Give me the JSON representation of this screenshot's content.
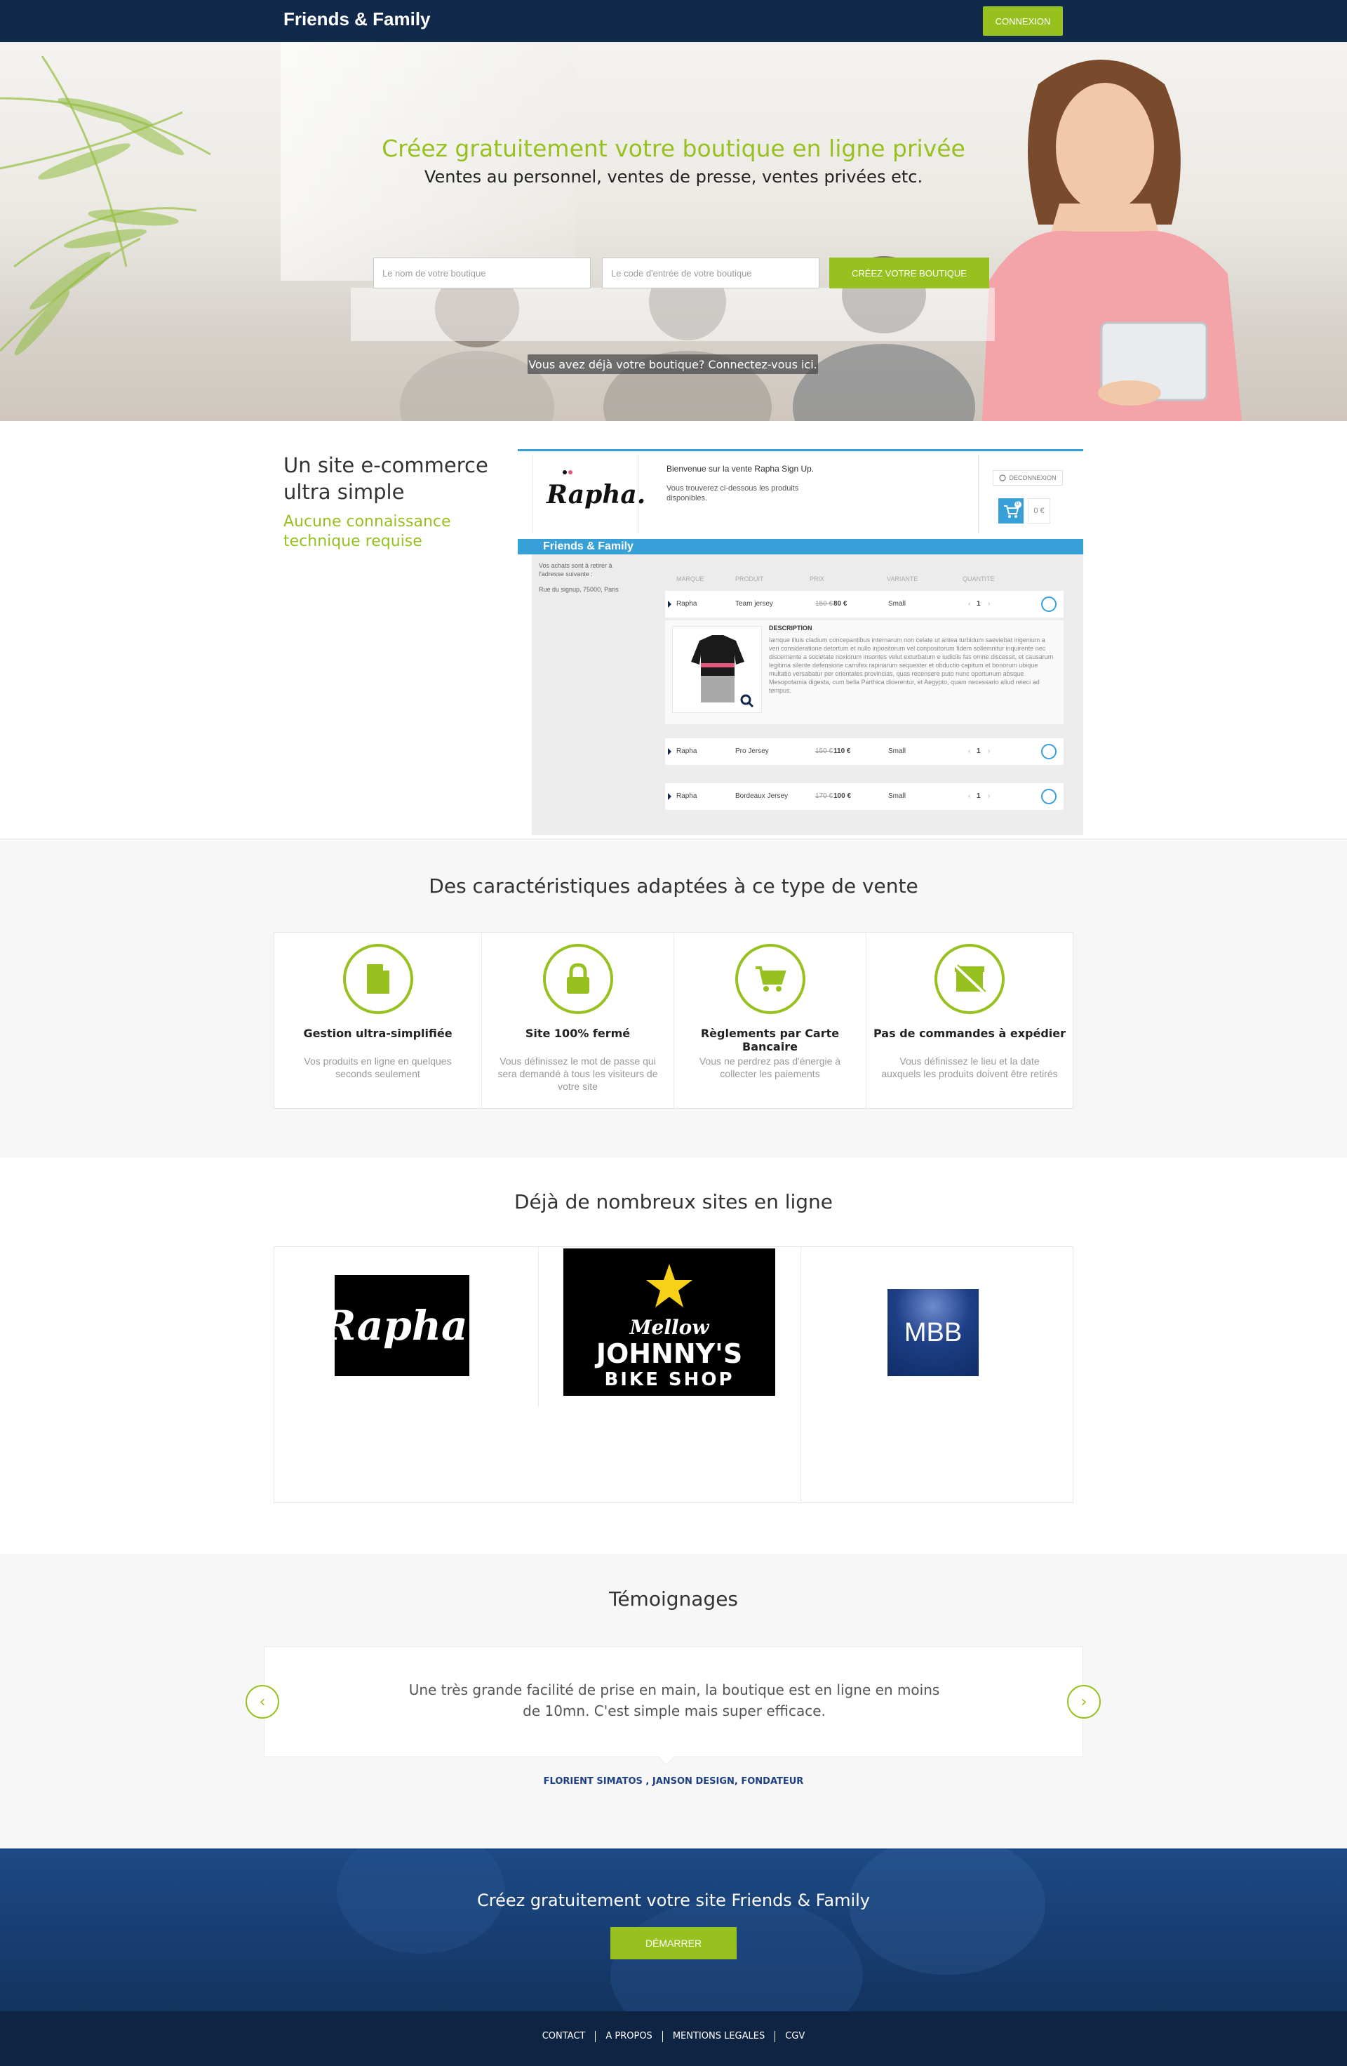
{
  "header": {
    "brand": "Friends & Family",
    "login_label": "CONNEXION"
  },
  "hero": {
    "title": "Créez gratuitement votre boutique en ligne privée",
    "subtitle": "Ventes au personnel, ventes de presse, ventes privées etc.",
    "shop_name_placeholder": "Le nom de votre boutique",
    "shop_code_placeholder": "Le code d'entrée de votre boutique",
    "create_label": "CRÉEZ VOTRE BOUTIQUE",
    "already_label": "Vous avez déjà votre boutique? Connectez-vous ici."
  },
  "ecommerce": {
    "title": "Un site e-commerce ultra simple",
    "subtitle": "Aucune connaissance technique requise",
    "mockup": {
      "logo": "Rapha.",
      "welcome": "Bienvenue sur la vente Rapha Sign Up.",
      "desc": "Vous trouverez ci-dessous les produits disponibles.",
      "logout": "DECONNEXION",
      "cart_count": "0",
      "cart_total": "0 €",
      "bar_title": "Friends & Family",
      "side_text_1": "Vos achats sont à retirer à l'adresse suivante :",
      "side_text_2": "Rue du signup, 75000, Paris",
      "columns": [
        "MARQUE",
        "PRODUIT",
        "PRIX",
        "VARIANTE",
        "QUANTITE"
      ],
      "rows": [
        {
          "brand": "Rapha",
          "product": "Team jersey",
          "old_price": "150 €",
          "price": "80 €",
          "variant": "Small",
          "qty": "1"
        },
        {
          "brand": "Rapha",
          "product": "Pro Jersey",
          "old_price": "150 €",
          "price": "110 €",
          "variant": "Small",
          "qty": "1"
        },
        {
          "brand": "Rapha",
          "product": "Bordeaux Jersey",
          "old_price": "170 €",
          "price": "100 €",
          "variant": "Small",
          "qty": "1"
        }
      ],
      "description_title": "DESCRIPTION",
      "description_text": "Iamque illuis cladium concepantibus internarum non celate ut antea turbidum saeviebat ingenium a veri consideratione detortum et nullo inpositorum vel conpositorum fidem sollemnitur inquirente nec discernente a societate noxiorum insontes velut exturbatum e iudiciis fas omne discessit, et causarum legitima silente defensione carnifex rapinarum sequester et obductio capitum et bonorum ubique multatio versabatur per orientales provincias, quas recensere puto nunc oportunum absque Mesopotamia digesta, cum bella Parthica dicerentur, et Aegypto, quam necessario aliud reieci ad tempus."
    }
  },
  "features": {
    "title": "Des caractéristiques adaptées à ce type de vente",
    "items": [
      {
        "icon": "document-icon",
        "title": "Gestion ultra-simplifiée",
        "text": "Vos produits en ligne en quelques seconds seulement"
      },
      {
        "icon": "lock-icon",
        "title": "Site 100% fermé",
        "text": "Vous définissez le mot de passe qui sera demandé à tous les visiteurs de votre site"
      },
      {
        "icon": "cart-icon",
        "title": "Règlements par Carte Bancaire",
        "text": "Vous ne perdrez pas d'énergie à collecter les paiements"
      },
      {
        "icon": "no-shipping-icon",
        "title": "Pas de commandes à expédier",
        "text": "Vous définissez le lieu et la date auxquels les produits doivent être retirés"
      }
    ]
  },
  "sites": {
    "title": "Déjà de nombreux sites en ligne",
    "logos": {
      "rapha": "Rapha.",
      "mjbs_1": "Mellow",
      "mjbs_2": "JOHNNY'S",
      "mjbs_3": "BIKE SHOP",
      "mbb": "MBB"
    }
  },
  "testimonials": {
    "title": "Témoignages",
    "quote": "Une très grande facilité de prise en main, la boutique est en ligne en moins de 10mn. C'est simple mais super efficace.",
    "author": "FLORIENT SIMATOS , JANSON DESIGN, FONDATEUR",
    "prev": "‹",
    "next": "›"
  },
  "cta": {
    "title": "Créez gratuitement votre site Friends & Family",
    "button": "DÉMARRER"
  },
  "footer": {
    "links": [
      "CONTACT",
      "A PROPOS",
      "MENTIONS LEGALES",
      "CGV"
    ]
  },
  "colors": {
    "navy": "#11294b",
    "green": "#97c11f",
    "blue": "#38a0d8"
  }
}
